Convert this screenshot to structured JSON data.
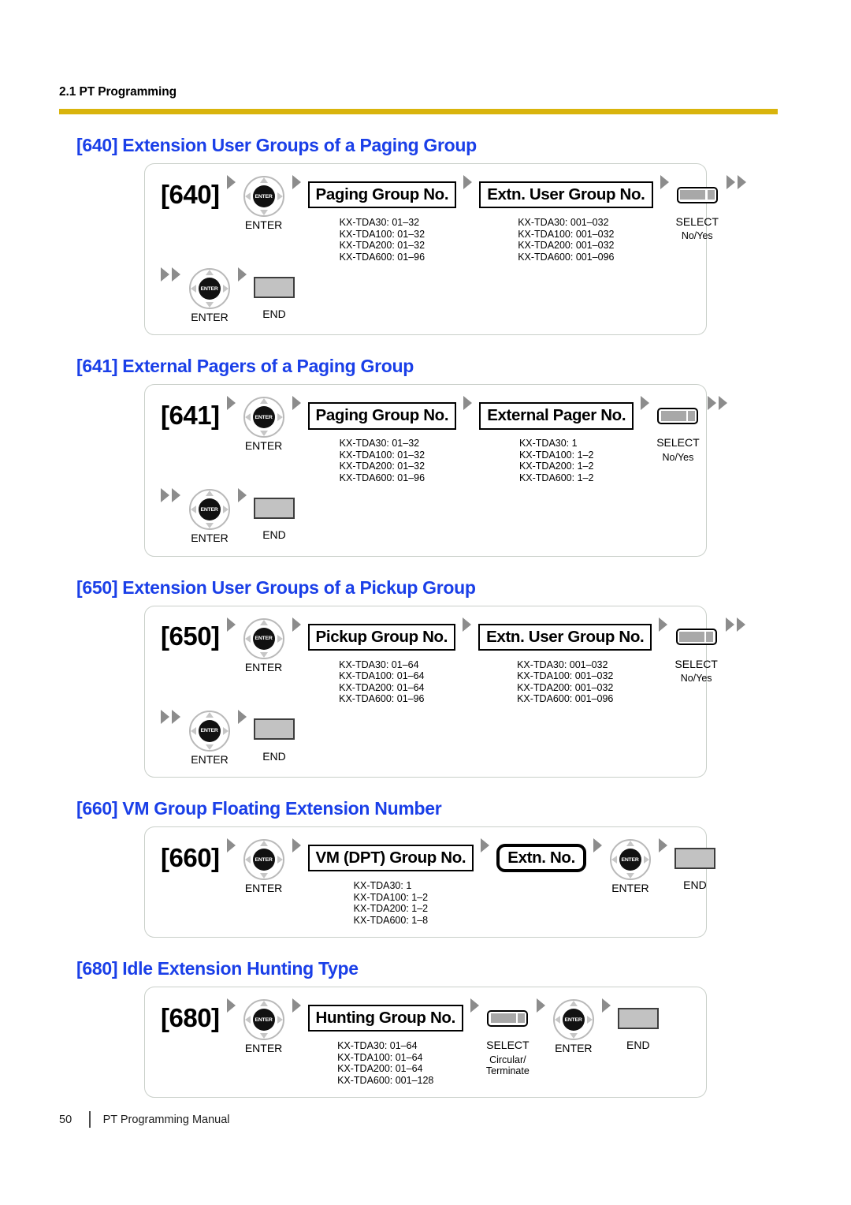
{
  "header": {
    "running_head": "2.1 PT Programming",
    "rule_color": "#d9b40c"
  },
  "theme": {
    "heading_color": "#1a3fe8",
    "arrow_color": "#8c8c8c",
    "panel_border": "#c9cfc9",
    "end_key_fill": "#c2c2c2",
    "select_seg_fill": "#a8a8a8"
  },
  "labels": {
    "enter": "ENTER",
    "select": "SELECT",
    "end": "END"
  },
  "sections": [
    {
      "id": "640",
      "title": "[640] Extension User Groups of a Paging Group",
      "code": "[640]",
      "field1": "Paging Group No.",
      "field1_ranges": [
        "KX-TDA30: 01–32",
        "KX-TDA100: 01–32",
        "KX-TDA200: 01–32",
        "KX-TDA600: 01–96"
      ],
      "field2": "Extn. User Group No.",
      "field2_ranges": [
        "KX-TDA30: 001–032",
        "KX-TDA100: 001–032",
        "KX-TDA200: 001–032",
        "KX-TDA600: 001–096"
      ],
      "select_options": "No/Yes"
    },
    {
      "id": "641",
      "title": "[641] External Pagers of a Paging Group",
      "code": "[641]",
      "field1": "Paging Group No.",
      "field1_ranges": [
        "KX-TDA30: 01–32",
        "KX-TDA100: 01–32",
        "KX-TDA200: 01–32",
        "KX-TDA600: 01–96"
      ],
      "field2": "External Pager No.",
      "field2_ranges": [
        "KX-TDA30: 1",
        "KX-TDA100: 1–2",
        "KX-TDA200: 1–2",
        "KX-TDA600: 1–2"
      ],
      "select_options": "No/Yes"
    },
    {
      "id": "650",
      "title": "[650] Extension User Groups of a Pickup Group",
      "code": "[650]",
      "field1": "Pickup Group No.",
      "field1_ranges": [
        "KX-TDA30: 01–64",
        "KX-TDA100: 01–64",
        "KX-TDA200: 01–64",
        "KX-TDA600: 01–96"
      ],
      "field2": "Extn. User Group No.",
      "field2_ranges": [
        "KX-TDA30: 001–032",
        "KX-TDA100: 001–032",
        "KX-TDA200: 001–032",
        "KX-TDA600: 001–096"
      ],
      "select_options": "No/Yes"
    },
    {
      "id": "660",
      "title": "[660] VM Group Floating Extension Number",
      "code": "[660]",
      "field1": "VM (DPT) Group No.",
      "field1_ranges": [
        "KX-TDA30: 1",
        "KX-TDA100: 1–2",
        "KX-TDA200: 1–2",
        "KX-TDA600: 1–8"
      ],
      "field2": "Extn. No.",
      "field2_ranges": [],
      "select_options": null
    },
    {
      "id": "680",
      "title": "[680] Idle Extension Hunting Type",
      "code": "[680]",
      "field1": "Hunting Group No.",
      "field1_ranges": [
        "KX-TDA30: 01–64",
        "KX-TDA100: 01–64",
        "KX-TDA200: 01–64",
        "KX-TDA600: 001–128"
      ],
      "field2": null,
      "field2_ranges": [],
      "select_options_lines": [
        "Circular/",
        "Terminate"
      ]
    }
  ],
  "footer": {
    "page_number": "50",
    "manual_title": "PT Programming Manual"
  }
}
